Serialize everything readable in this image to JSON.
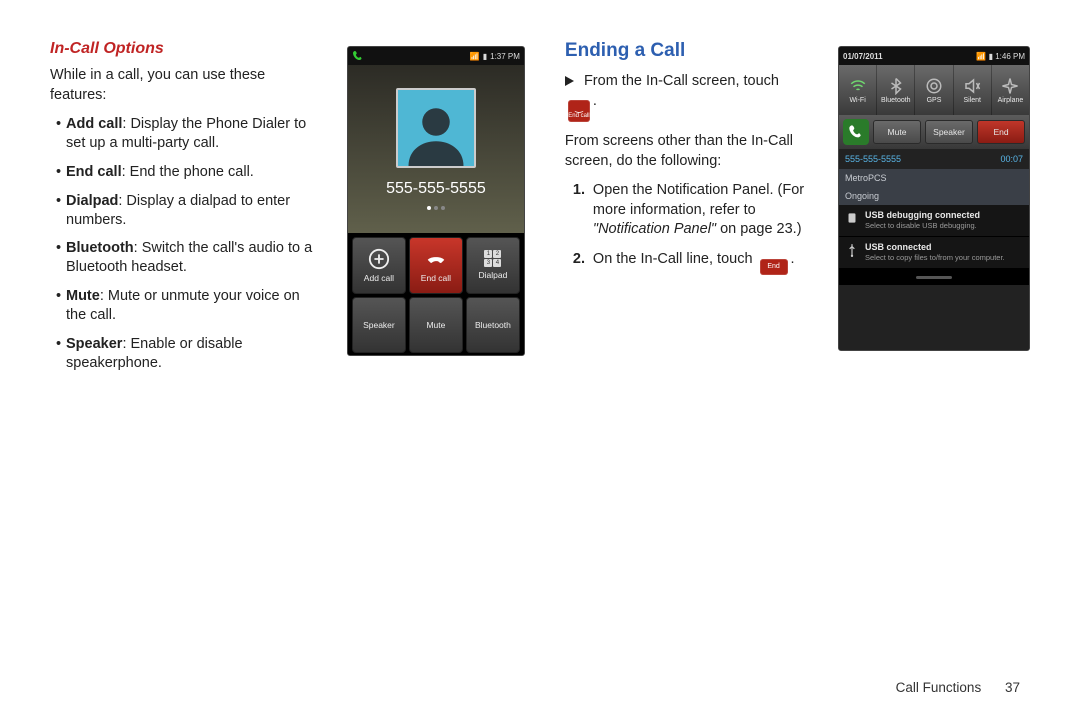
{
  "left": {
    "heading": "In-Call Options",
    "intro": "While in a call, you can use these features:",
    "items": [
      {
        "b": "Add call",
        "t": ": Display the Phone Dialer to set up a multi-party call."
      },
      {
        "b": "End call",
        "t": ": End the phone call."
      },
      {
        "b": "Dialpad",
        "t": ": Display a dialpad to enter numbers."
      },
      {
        "b": "Bluetooth",
        "t": ": Switch the call's audio to a Bluetooth headset."
      },
      {
        "b": "Mute",
        "t": ": Mute or unmute your voice on the call."
      },
      {
        "b": "Speaker",
        "t": ": Enable or disable speakerphone."
      }
    ]
  },
  "phone1": {
    "status_time": "1:37 PM",
    "number": "555-555-5555",
    "buttons": [
      "Add call",
      "End call",
      "Dialpad",
      "Speaker",
      "Mute",
      "Bluetooth"
    ]
  },
  "right": {
    "heading": "Ending a Call",
    "line1a": "From the In-Call screen, touch",
    "endcall_label": "End call",
    "line2": "From screens other than the In-Call screen, do the following:",
    "step1a": "Open the Notification Panel. (For more information, refer to ",
    "step1b": "\"Notification Panel\"",
    "step1c": " on page 23.)",
    "step2a": "On the In-Call line, touch ",
    "end_small": "End"
  },
  "phone2": {
    "date": "01/07/2011",
    "time": "1:46 PM",
    "toggles": [
      "Wi-Fi",
      "Bluetooth",
      "GPS",
      "Silent",
      "Airplane"
    ],
    "row_btns": [
      "Mute",
      "Speaker",
      "End"
    ],
    "info_num": "555-555-5555",
    "info_dur": "00:07",
    "carrier": "MetroPCS",
    "ongoing": "Ongoing",
    "n1t": "USB debugging connected",
    "n1s": "Select to disable USB debugging.",
    "n2t": "USB connected",
    "n2s": "Select to copy files to/from your computer."
  },
  "footer": {
    "section": "Call Functions",
    "page": "37"
  }
}
